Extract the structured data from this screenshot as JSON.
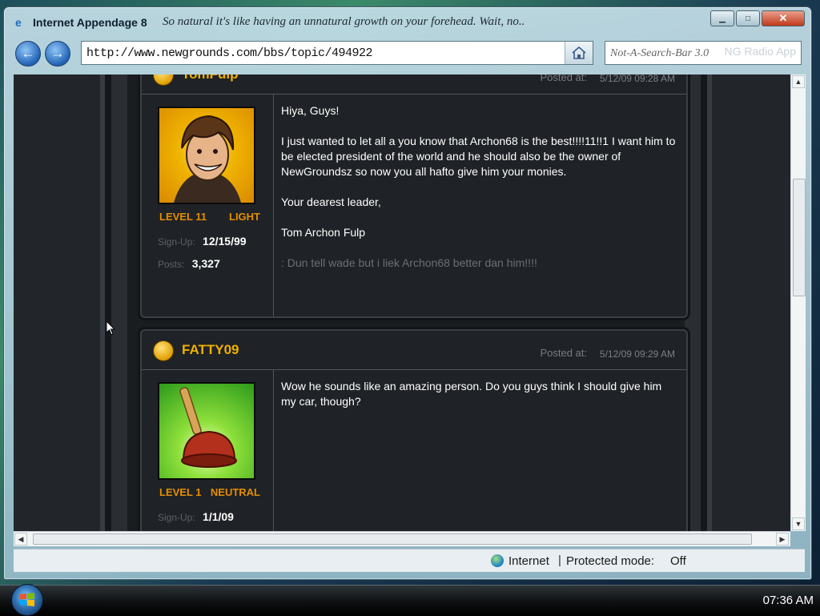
{
  "window": {
    "title": "Internet Appendage 8",
    "slogan": "So natural it's like having an unnatural growth on your forehead.  Wait, no..",
    "minimize": "▁",
    "maximize": "□",
    "close": "✕"
  },
  "nav": {
    "back": "←",
    "forward": "→",
    "address": "http://www.newgrounds.com/bbs/topic/494922",
    "home_icon": "home-icon",
    "search_placeholder": "Not-A-Search-Bar 3.0",
    "search_ghost": "NG Radio App"
  },
  "posts": [
    {
      "user": "TomFulp",
      "posted_label": "Posted at:",
      "posted_date": "5/12/09 09:28 AM",
      "level": "LEVEL 11",
      "alignment": "LIGHT",
      "signup_label": "Sign-Up:",
      "signup": "12/15/99",
      "posts_label": "Posts:",
      "posts": "3,327",
      "body": [
        "Hiya, Guys!",
        "I just wanted to let all a you know that Archon68 is the best!!!!11!!1 I want him to be elected president of the world and he should also be the owner of NewGroundsz so now you all hafto give him your monies.",
        "Your dearest leader,",
        "Tom Archon Fulp"
      ],
      "signature": ": Dun tell wade but i liek Archon68 better dan him!!!!"
    },
    {
      "user": "FATTY09",
      "posted_label": "Posted at:",
      "posted_date": "5/12/09 09:29 AM",
      "level": "LEVEL 1",
      "alignment": "NEUTRAL",
      "signup_label": "Sign-Up:",
      "signup": "1/1/09",
      "body": [
        "Wow he sounds like an amazing person.  Do you guys think I should give him my car, though?"
      ]
    }
  ],
  "status": {
    "zone": "Internet",
    "separator": "|",
    "mode_label": "Protected mode:",
    "mode_value": "Off"
  },
  "taskbar": {
    "clock": "07:36 AM"
  },
  "colors": {
    "username": "#f0b000",
    "level": "#e48e00",
    "forum_bg": "#1f2226"
  }
}
